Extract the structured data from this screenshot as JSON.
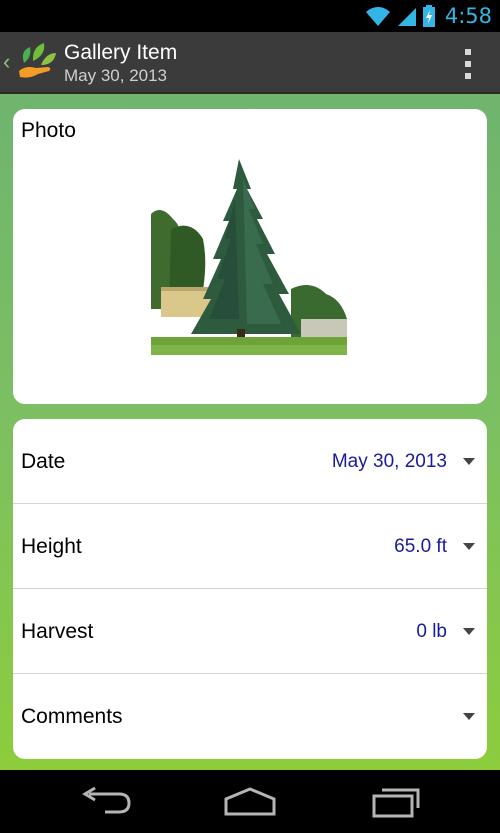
{
  "status_bar": {
    "time": "4:58",
    "icons": [
      "wifi-icon",
      "signal-icon",
      "battery-charging-icon"
    ]
  },
  "action_bar": {
    "title": "Gallery Item",
    "subtitle": "May 30, 2013",
    "icons": [
      "up-caret-icon",
      "app-logo-icon",
      "overflow-menu-icon"
    ]
  },
  "photo_card": {
    "label": "Photo",
    "image": "tree-photo"
  },
  "form": {
    "rows": [
      {
        "label": "Date",
        "value": "May 30, 2013"
      },
      {
        "label": "Height",
        "value": "65.0 ft"
      },
      {
        "label": "Harvest",
        "value": "0 lb"
      },
      {
        "label": "Comments",
        "value": ""
      }
    ]
  },
  "nav_bar": {
    "icons": [
      "back-icon",
      "home-icon",
      "recent-apps-icon"
    ]
  },
  "colors": {
    "accent_time": "#33b5e5",
    "value_text": "#1a1aa0",
    "action_bar": "#3b3b3b",
    "background_top": "#6fb46f",
    "background_bottom": "#8ccd3c"
  }
}
